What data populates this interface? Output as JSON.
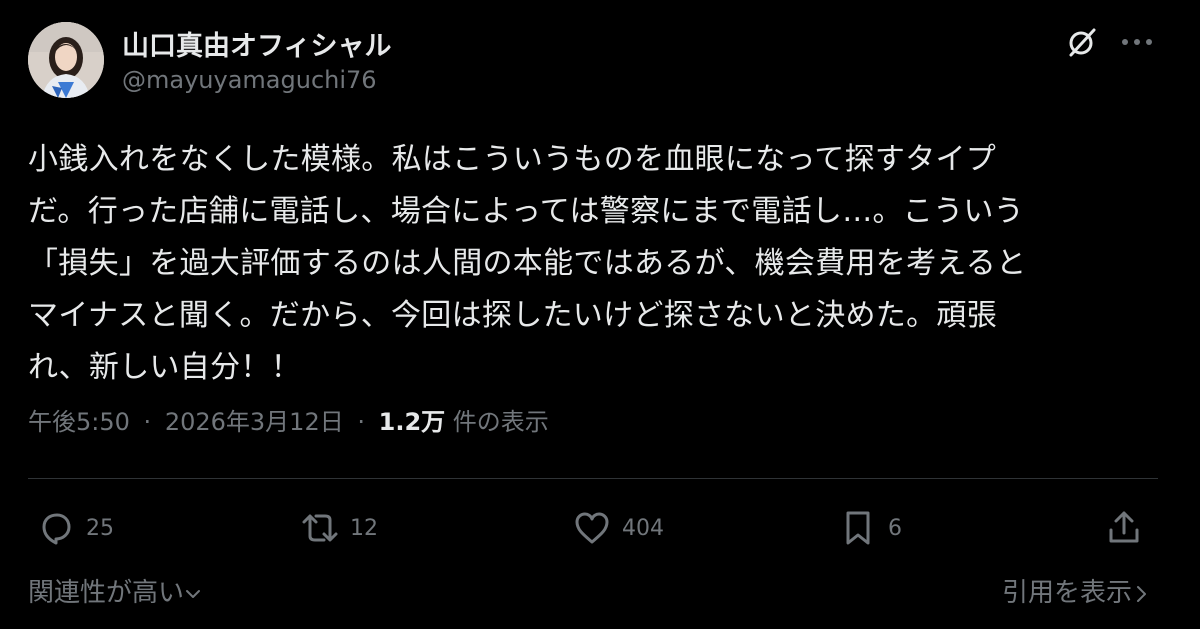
{
  "author": {
    "display_name": "山口真由オフィシャル",
    "handle": "@mayuyamaguchi76"
  },
  "header_icons": [
    "grok-icon",
    "more-icon"
  ],
  "tweet": {
    "lines": [
      "小銭入れをなくした模様。私はこういうものを血眼になって探すタイプ",
      "だ。行った店舗に電話し、場合によっては警察にまで電話し…。こういう",
      "「損失」を過大評価するのは人間の本能ではあるが、機会費用を考えると",
      "マイナスと聞く。だから、今回は探したいけど探さないと決めた。頑張",
      "れ、新しい自分！！"
    ]
  },
  "meta": {
    "time": "午後5:50",
    "separator": "·",
    "date": "2026年3月12日",
    "views_count": "1.2万",
    "views_label": "件の表示"
  },
  "actions": {
    "reply_count": "25",
    "repost_count": "12",
    "like_count": "404",
    "bookmark_count": "6"
  },
  "footer": {
    "sort_label": "関連性が高い",
    "quotes_label": "引用を表示"
  },
  "colors": {
    "background": "#000000",
    "text_primary": "#e7e9ea",
    "text_secondary": "#71767b",
    "divider": "#2f3336"
  }
}
